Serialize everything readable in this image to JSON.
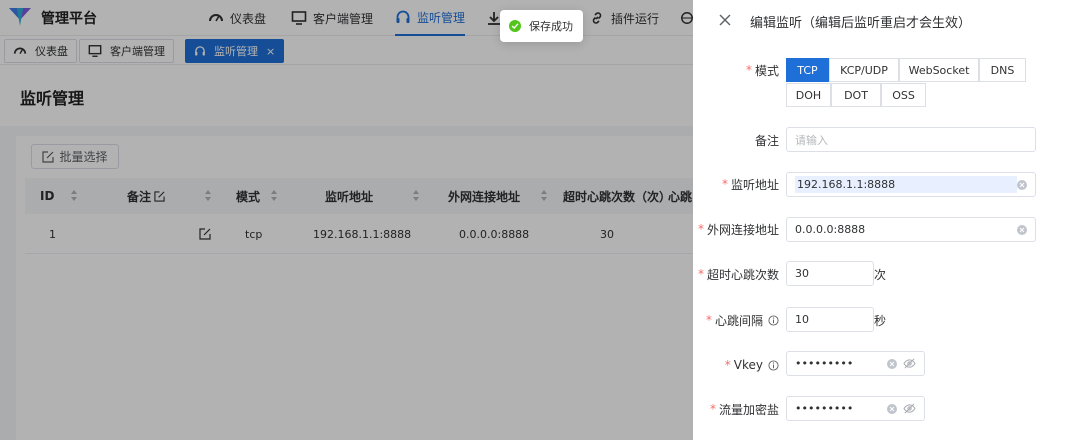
{
  "app": {
    "title": "管理平台"
  },
  "nav": [
    {
      "label": "仪表盘",
      "icon": "dashboard-icon"
    },
    {
      "label": "客户端管理",
      "icon": "monitor-icon"
    },
    {
      "label": "监听管理",
      "icon": "headphones-icon",
      "active": true
    },
    {
      "label": "插件运行",
      "icon": "link-icon"
    }
  ],
  "tags": [
    {
      "label": "仪表盘",
      "icon": "dashboard-icon"
    },
    {
      "label": "客户端管理",
      "icon": "monitor-icon"
    },
    {
      "label": "监听管理",
      "icon": "headphones-icon",
      "active": true,
      "close": "×"
    }
  ],
  "page": {
    "title": "监听管理",
    "batch_label": "批量选择"
  },
  "table": {
    "columns": [
      "ID",
      "备注",
      "模式",
      "监听地址",
      "外网连接地址",
      "超时心跳次数（次）",
      "心跳"
    ],
    "rows": [
      {
        "id": "1",
        "mode": "tcp",
        "listen": "192.168.1.1:8888",
        "public": "0.0.0.0:8888",
        "timeout": "30"
      }
    ]
  },
  "toast": {
    "text": "保存成功",
    "color": "#52c41a"
  },
  "drawer": {
    "title": "编辑监听（编辑后监听重启才会生效）",
    "fields": {
      "mode_label": "模式",
      "mode_options": [
        "TCP",
        "KCP/UDP",
        "WebSocket",
        "DNS",
        "DOH",
        "DOT",
        "OSS"
      ],
      "mode_selected": "TCP",
      "remark_label": "备注",
      "remark_placeholder": "请输入",
      "listen_label": "监听地址",
      "listen_value": "192.168.1.1:8888",
      "public_label": "外网连接地址",
      "public_value": "0.0.0.0:8888",
      "timeout_label": "超时心跳次数",
      "timeout_value": "30",
      "timeout_unit": "次",
      "interval_label": "心跳间隔",
      "interval_value": "10",
      "interval_unit": "秒",
      "vkey_label": "Vkey",
      "vkey_value": "•••••••••",
      "salt_label": "流量加密盐",
      "salt_value": "•••••••••"
    }
  },
  "colors": {
    "accent": "#1f6fd8",
    "required": "#f56c6c"
  }
}
